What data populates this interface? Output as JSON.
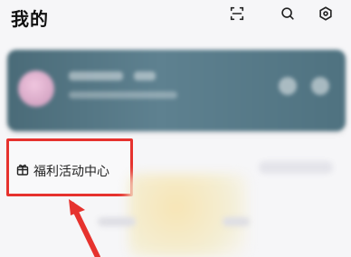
{
  "header": {
    "title": "我的",
    "icons": [
      "scan-icon",
      "search-icon",
      "settings-icon"
    ]
  },
  "profile": {
    "avatar_color": "#d7a9c8",
    "card_color": "#4f7280"
  },
  "welfare": {
    "label": "福利活动中心",
    "icon": "gift-icon"
  },
  "annotation": {
    "highlight_color": "#e6322e"
  }
}
